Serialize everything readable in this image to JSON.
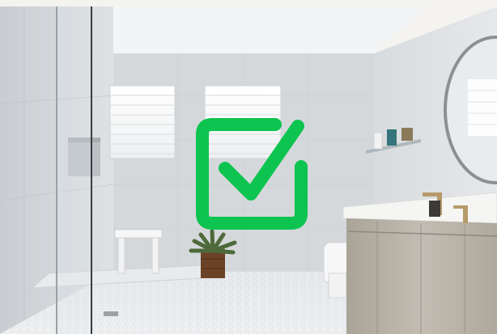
{
  "image": {
    "subject": "bathroom",
    "overlay_icon": "checkbox-checked-icon",
    "overlay_color": "#0cc44f"
  },
  "colors": {
    "page_bg": "#f5f3f0",
    "wall_tile": "#d9dcdf",
    "ceiling": "#f2f3f5",
    "floor_tile": "#e9ebee",
    "vanity_wood": "#b9b3a9",
    "countertop": "#f4f4f2",
    "fixture_brass": "#b59a6a",
    "mirror_frame": "#8e8f91",
    "plant_green": "#4e6a3b",
    "planter_wood": "#6b4226"
  }
}
